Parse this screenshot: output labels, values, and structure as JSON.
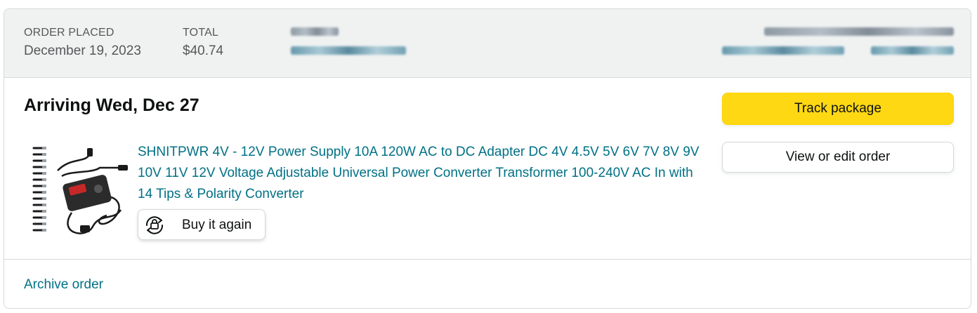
{
  "header": {
    "order_placed_label": "ORDER PLACED",
    "order_placed_value": "December 19, 2023",
    "total_label": "TOTAL",
    "total_value": "$40.74"
  },
  "shipment": {
    "arriving_text": "Arriving Wed, Dec 27"
  },
  "product": {
    "title": "SHNITPWR 4V - 12V Power Supply 10A 120W AC to DC Adapter DC 4V 4.5V 5V 6V 7V 8V 9V 10V 11V 12V Voltage Adjustable Universal Power Converter Transformer 100-240V AC In with 14 Tips & Polarity Converter",
    "image_icon": "power-supply-product-image"
  },
  "actions": {
    "buy_again_label": "Buy it again",
    "buy_again_icon": "reorder-icon",
    "track_package_label": "Track package",
    "view_edit_order_label": "View or edit order",
    "archive_order_label": "Archive order"
  },
  "colors": {
    "link": "#007185",
    "primary_button": "#ffd814",
    "header_bg": "#f0f2f2",
    "border": "#d5d9d9"
  }
}
